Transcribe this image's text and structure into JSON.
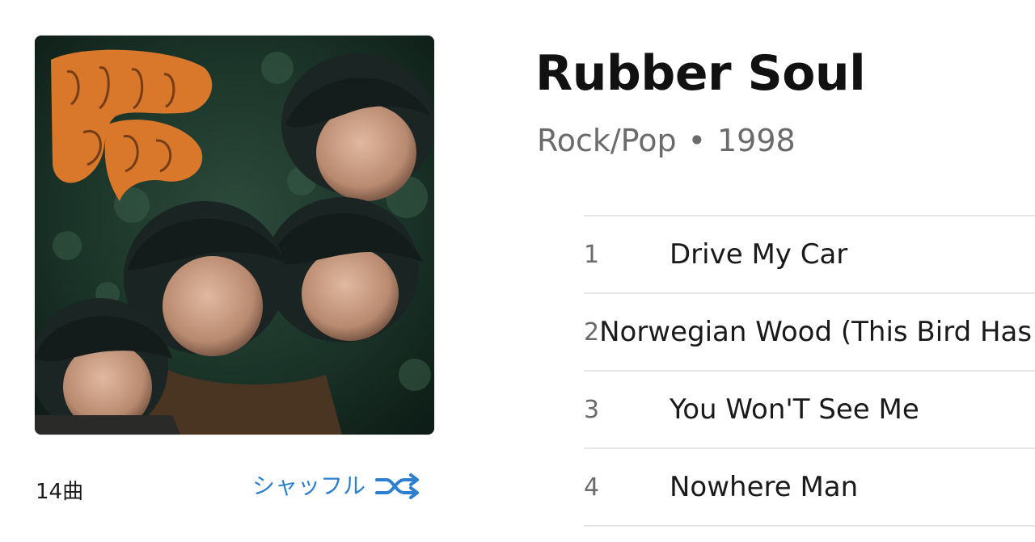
{
  "album": {
    "title": "Rubber Soul",
    "genre": "Rock/Pop",
    "separator": "•",
    "year": "1998",
    "art_title_text": "RUBBER SOUL",
    "art_icon": "album-cover-image"
  },
  "footer": {
    "track_count": "14曲",
    "shuffle_label": "シャッフル",
    "shuffle_icon": "shuffle-icon"
  },
  "tracks": [
    {
      "number": "1",
      "title": "Drive My Car"
    },
    {
      "number": "2",
      "title": "Norwegian Wood (This Bird Has Flown)"
    },
    {
      "number": "3",
      "title": "You Won'T See Me"
    },
    {
      "number": "4",
      "title": "Nowhere Man"
    }
  ],
  "colors": {
    "accent": "#2f7fd1",
    "title_text": "#111111",
    "meta_text": "#6b6b6b",
    "divider": "#e6e6e6",
    "cover_orange": "#d9772b"
  }
}
